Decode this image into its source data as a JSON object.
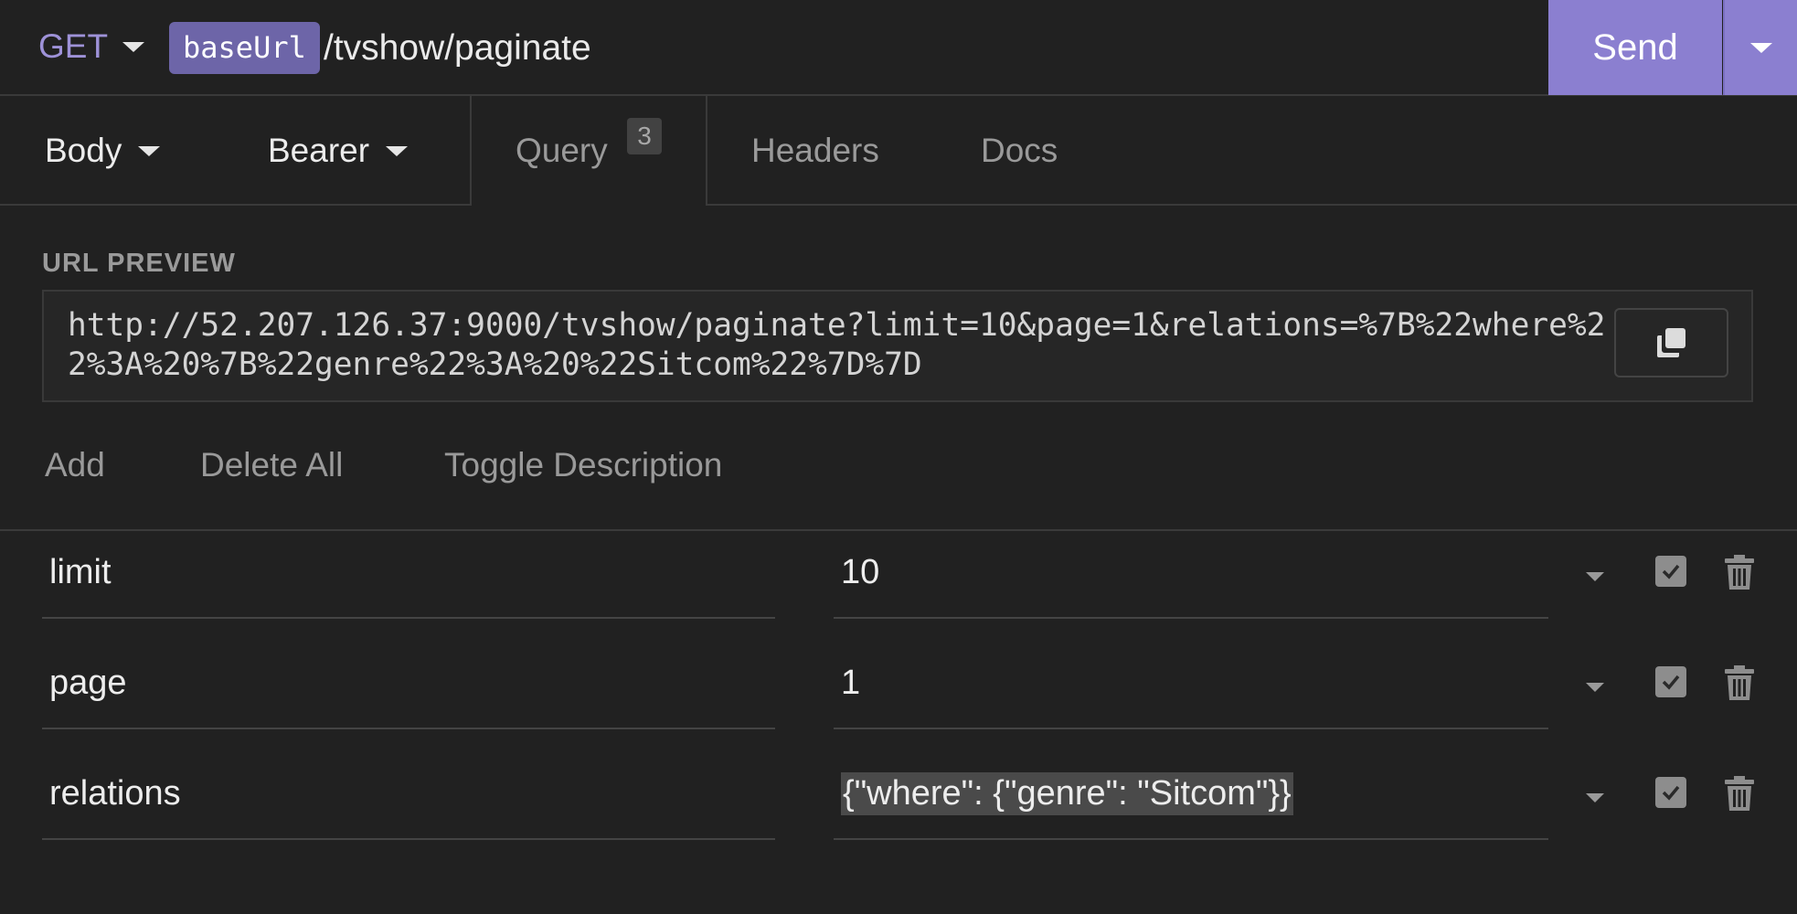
{
  "request": {
    "method": "GET",
    "base_url_tag": "baseUrl",
    "path": "/tvshow/paginate",
    "send_label": "Send"
  },
  "tabs": {
    "body": "Body",
    "bearer": "Bearer",
    "query": "Query",
    "query_count": "3",
    "headers": "Headers",
    "docs": "Docs"
  },
  "preview": {
    "label": "URL PREVIEW",
    "url": "http://52.207.126.37:9000/tvshow/paginate?limit=10&page=1&relations=%7B%22where%22%3A%20%7B%22genre%22%3A%20%22Sitcom%22%7D%7D"
  },
  "actions": {
    "add": "Add",
    "delete_all": "Delete All",
    "toggle_description": "Toggle Description"
  },
  "params": [
    {
      "name": "limit",
      "value": "10",
      "enabled": true
    },
    {
      "name": "page",
      "value": "1",
      "enabled": true
    },
    {
      "name": "relations",
      "value": "{\"where\": {\"genre\": \"Sitcom\"}}",
      "enabled": true
    }
  ],
  "colors": {
    "accent": "#8b7fd0",
    "method": "#9e92d8",
    "tag": "#6d65a8",
    "background": "#212121"
  }
}
